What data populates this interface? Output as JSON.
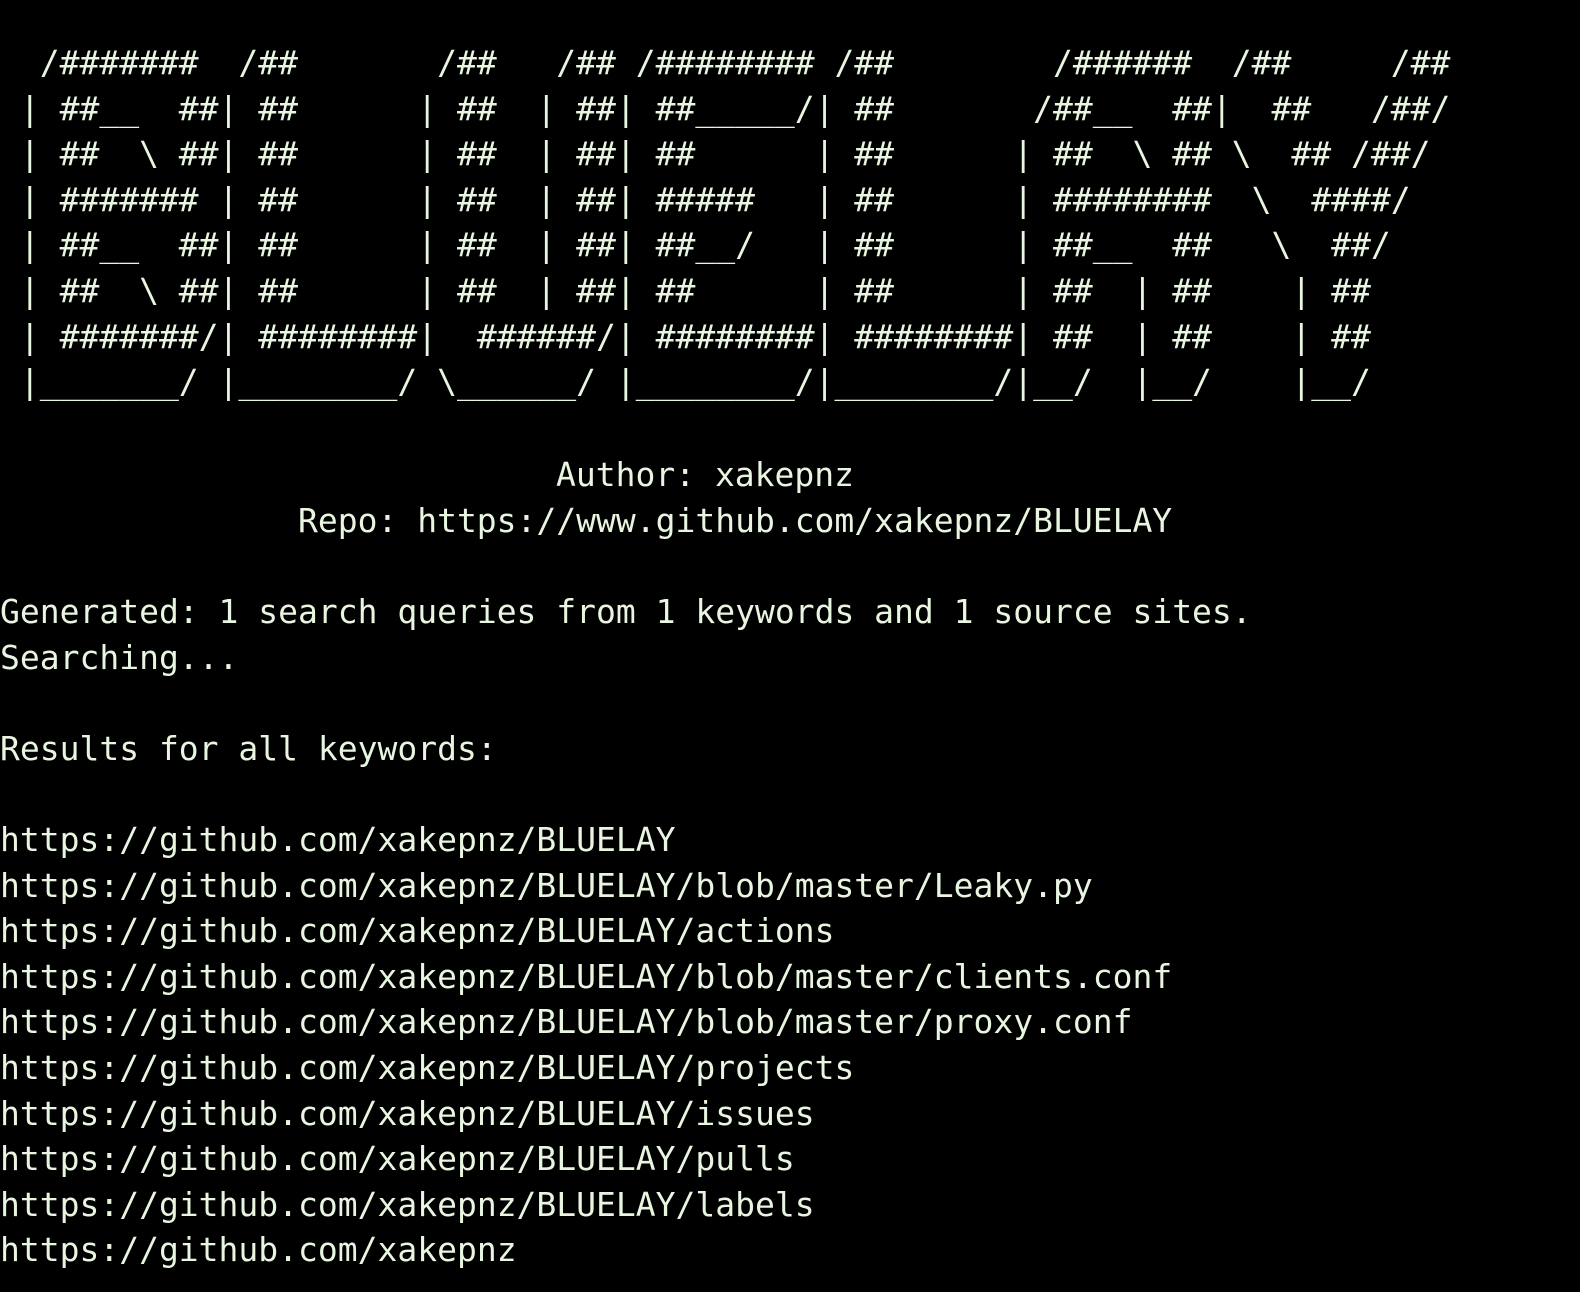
{
  "terminal": {
    "banner": [
      "  /#######  /##       /##   /## /######## /##        /######  /##     /##",
      " | ##__  ##| ##      | ##  | ##| ##_____/| ##       /##__  ##|  ##   /##/",
      " | ##  \\ ##| ##      | ##  | ##| ##      | ##      | ##  \\ ## \\  ## /##/",
      " | ####### | ##      | ##  | ##| #####   | ##      | ########  \\  ####/",
      " | ##__  ##| ##      | ##  | ##| ##__/   | ##      | ##__  ##   \\  ##/",
      " | ##  \\ ##| ##      | ##  | ##| ##      | ##      | ##  | ##    | ##",
      " | #######/| ########|  ######/| ########| ########| ##  | ##    | ##",
      " |_______/ |________/ \\______/ |________/|________/|__/  |__/    |__/"
    ],
    "author": "Author: xakepnz",
    "repo": "Repo: https://www.github.com/xakepnz/BLUELAY",
    "generated": "Generated: 1 search queries from 1 keywords and 1 source sites.",
    "searching": "Searching...",
    "results_header": "Results for all keywords:",
    "results": [
      "https://github.com/xakepnz/BLUELAY",
      "https://github.com/xakepnz/BLUELAY/blob/master/Leaky.py",
      "https://github.com/xakepnz/BLUELAY/actions",
      "https://github.com/xakepnz/BLUELAY/blob/master/clients.conf",
      "https://github.com/xakepnz/BLUELAY/blob/master/proxy.conf",
      "https://github.com/xakepnz/BLUELAY/projects",
      "https://github.com/xakepnz/BLUELAY/issues",
      "https://github.com/xakepnz/BLUELAY/pulls",
      "https://github.com/xakepnz/BLUELAY/labels",
      "https://github.com/xakepnz"
    ]
  },
  "colors": {
    "background": "#000000",
    "text": "#e8f5e0"
  }
}
